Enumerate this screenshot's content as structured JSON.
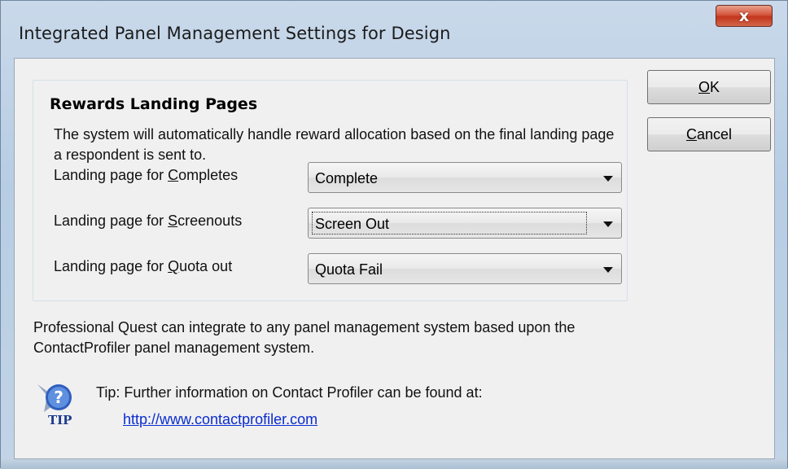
{
  "window": {
    "title": "Integrated Panel Management Settings for Design",
    "close_glyph": "x"
  },
  "group": {
    "title": "Rewards Landing Pages",
    "description": "The system will automatically handle reward allocation based on the final landing page a respondent is sent to."
  },
  "rows": [
    {
      "label_pre": "Landing page for ",
      "label_key": "C",
      "label_post": "ompletes",
      "value": "Complete"
    },
    {
      "label_pre": "Landing page for ",
      "label_key": "S",
      "label_post": "creenouts",
      "value": "Screen Out"
    },
    {
      "label_pre": "Landing page for ",
      "label_key": "Q",
      "label_post": "uota out",
      "value": "Quota Fail"
    }
  ],
  "buttons": {
    "ok_key": "O",
    "ok_rest": "K",
    "cancel_key": "C",
    "cancel_rest": "ancel"
  },
  "info": "Professional Quest can integrate to any panel management system based upon the ContactProfiler panel management system.",
  "tip": {
    "icon_label": "TIP",
    "text": "Tip: Further information on Contact Profiler can be found at:",
    "link": "http://www.contactprofiler.com"
  },
  "colors": {
    "close_button": "#c2351b",
    "link": "#0a2ccf"
  }
}
